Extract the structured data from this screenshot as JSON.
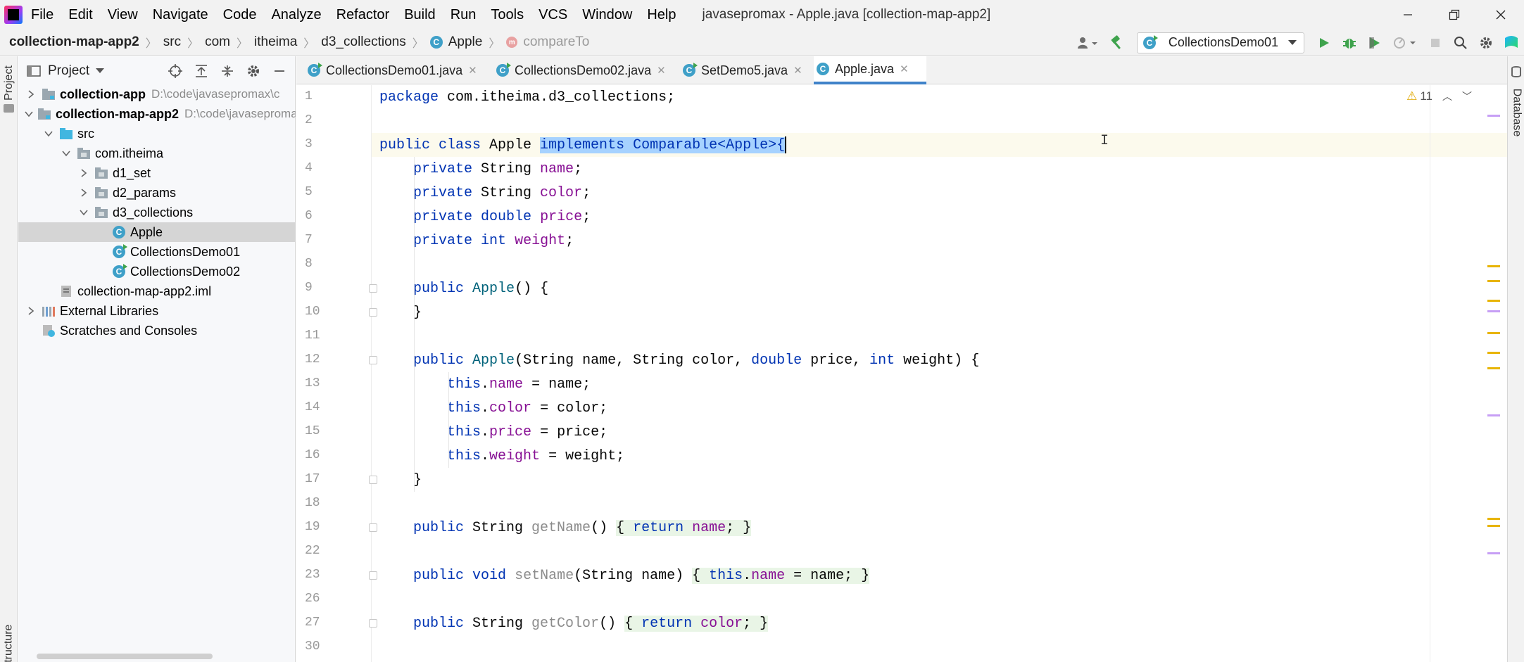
{
  "menubar": {
    "items": [
      "File",
      "Edit",
      "View",
      "Navigate",
      "Code",
      "Analyze",
      "Refactor",
      "Build",
      "Run",
      "Tools",
      "VCS",
      "Window",
      "Help"
    ],
    "title": "javasepromax - Apple.java [collection-map-app2]"
  },
  "navbar": {
    "crumbs": [
      "collection-map-app2",
      "src",
      "com",
      "itheima",
      "d3_collections",
      "Apple",
      "compareTo"
    ],
    "run_config": "CollectionsDemo01"
  },
  "side": {
    "left_tabs": [
      "Project",
      "Structure"
    ],
    "right_tabs": [
      "Database"
    ]
  },
  "project": {
    "title": "Project",
    "tree": [
      {
        "label": "collection-app",
        "path": "D:\\code\\javasepromax\\c",
        "bold": true,
        "level": 0,
        "arrow": "right",
        "icon": "module"
      },
      {
        "label": "collection-map-app2",
        "path": "D:\\code\\javasepromax\\",
        "bold": true,
        "level": 0,
        "arrow": "down",
        "icon": "module"
      },
      {
        "label": "src",
        "level": 1,
        "arrow": "down",
        "icon": "src-folder"
      },
      {
        "label": "com.itheima",
        "level": 2,
        "arrow": "down",
        "icon": "package"
      },
      {
        "label": "d1_set",
        "level": 3,
        "arrow": "right",
        "icon": "package"
      },
      {
        "label": "d2_params",
        "level": 3,
        "arrow": "right",
        "icon": "package"
      },
      {
        "label": "d3_collections",
        "level": 3,
        "arrow": "down",
        "icon": "package"
      },
      {
        "label": "Apple",
        "level": 4,
        "arrow": "none",
        "icon": "class",
        "selected": true
      },
      {
        "label": "CollectionsDemo01",
        "level": 4,
        "arrow": "none",
        "icon": "class-run"
      },
      {
        "label": "CollectionsDemo02",
        "level": 4,
        "arrow": "none",
        "icon": "class-run"
      },
      {
        "label": "collection-map-app2.iml",
        "level": 1,
        "arrow": "none",
        "icon": "iml"
      },
      {
        "label": "External Libraries",
        "level": 0,
        "arrow": "right",
        "icon": "libraries"
      },
      {
        "label": "Scratches and Consoles",
        "level": 0,
        "arrow": "none",
        "icon": "scratches"
      }
    ]
  },
  "tabs": [
    {
      "label": "CollectionsDemo01.java",
      "icon": "class-run",
      "active": false
    },
    {
      "label": "CollectionsDemo02.java",
      "icon": "class-run",
      "active": false
    },
    {
      "label": "SetDemo5.java",
      "icon": "class-run",
      "active": false
    },
    {
      "label": "Apple.java",
      "icon": "class",
      "active": true
    }
  ],
  "editor": {
    "warnings": "11",
    "lines": [
      {
        "n": "1",
        "segs": [
          {
            "t": "package",
            "c": "kw"
          },
          {
            "t": " com.itheima.d3_collections;"
          }
        ]
      },
      {
        "n": "2",
        "segs": []
      },
      {
        "n": "3",
        "segs": [
          {
            "t": "public class",
            "c": "kw"
          },
          {
            "t": " Apple "
          },
          {
            "t": "implements Comparable<Apple>{",
            "c": "kw-sel"
          }
        ]
      },
      {
        "n": "4",
        "segs": [
          {
            "t": "    "
          },
          {
            "t": "private",
            "c": "kw"
          },
          {
            "t": " String "
          },
          {
            "t": "name",
            "c": "fld"
          },
          {
            "t": ";"
          }
        ]
      },
      {
        "n": "5",
        "segs": [
          {
            "t": "    "
          },
          {
            "t": "private",
            "c": "kw"
          },
          {
            "t": " String "
          },
          {
            "t": "color",
            "c": "fld"
          },
          {
            "t": ";"
          }
        ]
      },
      {
        "n": "6",
        "segs": [
          {
            "t": "    "
          },
          {
            "t": "private double",
            "c": "kw"
          },
          {
            "t": " "
          },
          {
            "t": "price",
            "c": "fld"
          },
          {
            "t": ";"
          }
        ]
      },
      {
        "n": "7",
        "segs": [
          {
            "t": "    "
          },
          {
            "t": "private int",
            "c": "kw"
          },
          {
            "t": " "
          },
          {
            "t": "weight",
            "c": "fld"
          },
          {
            "t": ";"
          }
        ]
      },
      {
        "n": "8",
        "segs": []
      },
      {
        "n": "9",
        "segs": [
          {
            "t": "    "
          },
          {
            "t": "public",
            "c": "kw"
          },
          {
            "t": " "
          },
          {
            "t": "Apple",
            "c": "mth"
          },
          {
            "t": "() {"
          }
        ]
      },
      {
        "n": "10",
        "segs": [
          {
            "t": "    }"
          }
        ]
      },
      {
        "n": "11",
        "segs": []
      },
      {
        "n": "12",
        "segs": [
          {
            "t": "    "
          },
          {
            "t": "public",
            "c": "kw"
          },
          {
            "t": " "
          },
          {
            "t": "Apple",
            "c": "mth"
          },
          {
            "t": "(String name, String color, "
          },
          {
            "t": "double",
            "c": "kw"
          },
          {
            "t": " price, "
          },
          {
            "t": "int",
            "c": "kw"
          },
          {
            "t": " weight) {"
          }
        ]
      },
      {
        "n": "13",
        "segs": [
          {
            "t": "        "
          },
          {
            "t": "this",
            "c": "kw"
          },
          {
            "t": "."
          },
          {
            "t": "name",
            "c": "fld"
          },
          {
            "t": " = name;"
          }
        ]
      },
      {
        "n": "14",
        "segs": [
          {
            "t": "        "
          },
          {
            "t": "this",
            "c": "kw"
          },
          {
            "t": "."
          },
          {
            "t": "color",
            "c": "fld"
          },
          {
            "t": " = color;"
          }
        ]
      },
      {
        "n": "15",
        "segs": [
          {
            "t": "        "
          },
          {
            "t": "this",
            "c": "kw"
          },
          {
            "t": "."
          },
          {
            "t": "price",
            "c": "fld"
          },
          {
            "t": " = price;"
          }
        ]
      },
      {
        "n": "16",
        "segs": [
          {
            "t": "        "
          },
          {
            "t": "this",
            "c": "kw"
          },
          {
            "t": "."
          },
          {
            "t": "weight",
            "c": "fld"
          },
          {
            "t": " = weight;"
          }
        ]
      },
      {
        "n": "17",
        "segs": [
          {
            "t": "    }"
          }
        ]
      },
      {
        "n": "18",
        "segs": []
      },
      {
        "n": "19",
        "segs": [
          {
            "t": "    "
          },
          {
            "t": "public",
            "c": "kw"
          },
          {
            "t": " String "
          },
          {
            "t": "getName",
            "c": "gray"
          },
          {
            "t": "() "
          },
          {
            "t": "{ ",
            "c": "fh"
          },
          {
            "t": "return",
            "c": "kw-fh"
          },
          {
            "t": " ",
            "c": "fh"
          },
          {
            "t": "name",
            "c": "fld-fh"
          },
          {
            "t": "; }",
            "c": "fh"
          }
        ]
      },
      {
        "n": "22",
        "segs": []
      },
      {
        "n": "23",
        "segs": [
          {
            "t": "    "
          },
          {
            "t": "public void",
            "c": "kw"
          },
          {
            "t": " "
          },
          {
            "t": "setName",
            "c": "gray"
          },
          {
            "t": "(String name) "
          },
          {
            "t": "{ ",
            "c": "fh"
          },
          {
            "t": "this",
            "c": "kw-fh"
          },
          {
            "t": ".",
            "c": "fh"
          },
          {
            "t": "name",
            "c": "fld-fh"
          },
          {
            "t": " = name; }",
            "c": "fh"
          }
        ]
      },
      {
        "n": "26",
        "segs": []
      },
      {
        "n": "27",
        "segs": [
          {
            "t": "    "
          },
          {
            "t": "public",
            "c": "kw"
          },
          {
            "t": " String "
          },
          {
            "t": "getColor",
            "c": "gray"
          },
          {
            "t": "() "
          },
          {
            "t": "{ ",
            "c": "fh"
          },
          {
            "t": "return",
            "c": "kw-fh"
          },
          {
            "t": " ",
            "c": "fh"
          },
          {
            "t": "color",
            "c": "fld-fh"
          },
          {
            "t": "; }",
            "c": "fh"
          }
        ]
      },
      {
        "n": "30",
        "segs": []
      }
    ]
  }
}
